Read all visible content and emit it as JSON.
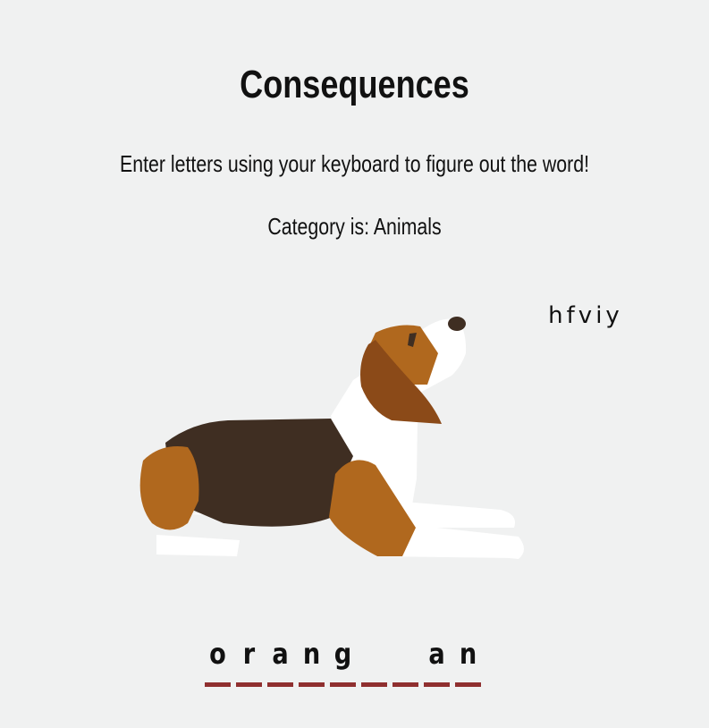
{
  "title": "Consequences",
  "instructions": "Enter letters using your keyboard to figure out the word!",
  "category": "Category is: Animals",
  "wrong_letters": "hfviy",
  "word_slots": [
    "o",
    "r",
    "a",
    "n",
    "g",
    "",
    "",
    "a",
    "n"
  ],
  "colors": {
    "background": "#f0f1f1",
    "underline": "#8f2f2f",
    "dog_brown": "#b0681e",
    "dog_dark": "#3f2e22",
    "dog_ear": "#8b4a18"
  },
  "illustration": "beagle-dog"
}
